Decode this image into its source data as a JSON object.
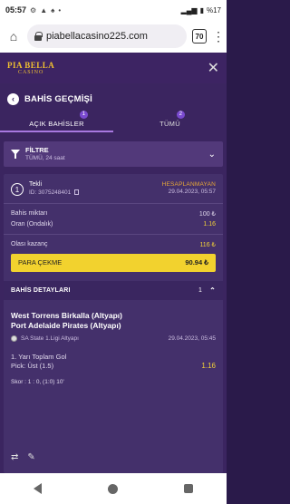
{
  "status_bar": {
    "time": "05:57",
    "notif_icons": [
      "⚙",
      "▲",
      "♠",
      "•"
    ],
    "right_text": "%17"
  },
  "browser": {
    "url": "piabellacasino225.com",
    "tab_count": "70"
  },
  "app": {
    "logo_line1": "PIA BELLA",
    "logo_line2": "CASINO"
  },
  "page": {
    "title": "BAHİS GEÇMİŞİ",
    "tabs": [
      {
        "label": "AÇIK BAHİSLER",
        "badge": "1"
      },
      {
        "label": "TÜMÜ",
        "badge": "2"
      }
    ]
  },
  "filter": {
    "title": "FİLTRE",
    "subtitle": "TÜMÜ, 24 saat"
  },
  "bet": {
    "index": "1",
    "type": "Tekli",
    "id": "ID: 3075248401",
    "status": "HESAPLANMAYAN",
    "date": "29.04.2023, 05:57",
    "amount_label": "Bahis miktarı",
    "amount_value": "100 ₺",
    "odds_label": "Oran (Ondalık)",
    "odds_value": "1.16",
    "win_label": "Olası kazanç",
    "win_value": "116 ₺",
    "cashout_label": "PARA ÇEKME",
    "cashout_value": "90.94 ₺",
    "details": {
      "title": "BAHİS DETAYLARI",
      "count": "1",
      "team1": "West Torrens Birkalla (Altyapı)",
      "team2": "Port Adelaide Pirates (Altyapı)",
      "league": "SA State 1.Ligi Altyapı",
      "match_date": "29.04.2023, 05:45",
      "market": "1. Yarı Toplam Gol",
      "pick": "Pick: Üst (1.5)",
      "pick_odd": "1.16",
      "score": "Skor : 1 : 0, (1:0) 10'"
    }
  }
}
